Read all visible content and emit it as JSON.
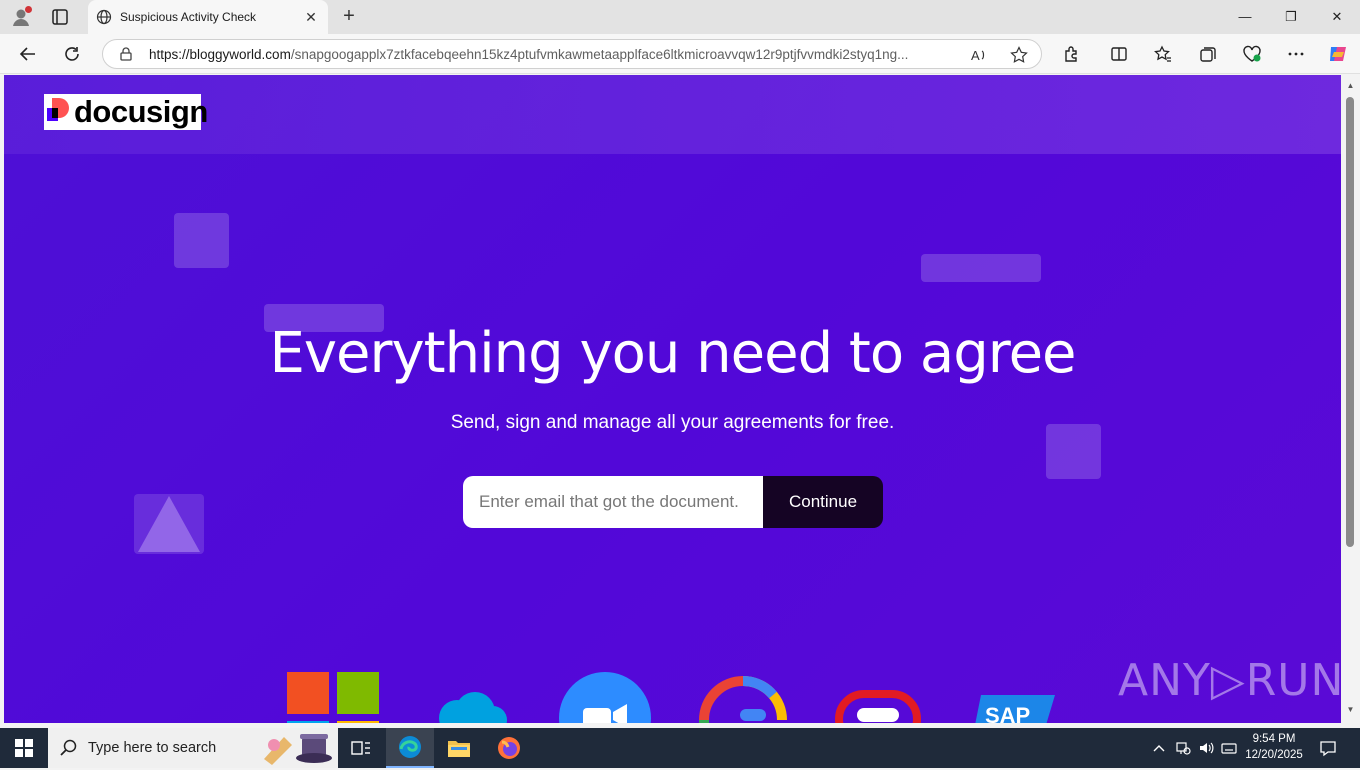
{
  "browser": {
    "tab_title": "Suspicious Activity Check",
    "url_host": "https://bloggyworld.com",
    "url_path": "/snapgoogapplx7ztkfacebqeehn15kz4ptufvmkawmetaapplface6ltkmicroavvqw12r9ptjfvvmdki2styq1ng...",
    "new_tab_label": "+",
    "close_tab_label": "✕",
    "minimize_label": "—",
    "restore_label": "❐",
    "close_label": "✕"
  },
  "page": {
    "logo_text": "docusign",
    "hero_title": "Everything you need to agree",
    "hero_subtitle": "Send, sign and manage all your agreements for free.",
    "email_placeholder": "Enter email that got the document.",
    "continue_label": "Continue",
    "brands": [
      "microsoft-logo",
      "salesforce-cloud-logo",
      "zoom-logo",
      "google-logo",
      "oracle-logo",
      "sap-logo"
    ],
    "sap_text": "SAP",
    "watermark": "ANY▷RUN",
    "bg_color": "#5208d8"
  },
  "taskbar": {
    "search_placeholder": "Type here to search",
    "time": "9:54 PM",
    "date": "12/20/2025"
  }
}
